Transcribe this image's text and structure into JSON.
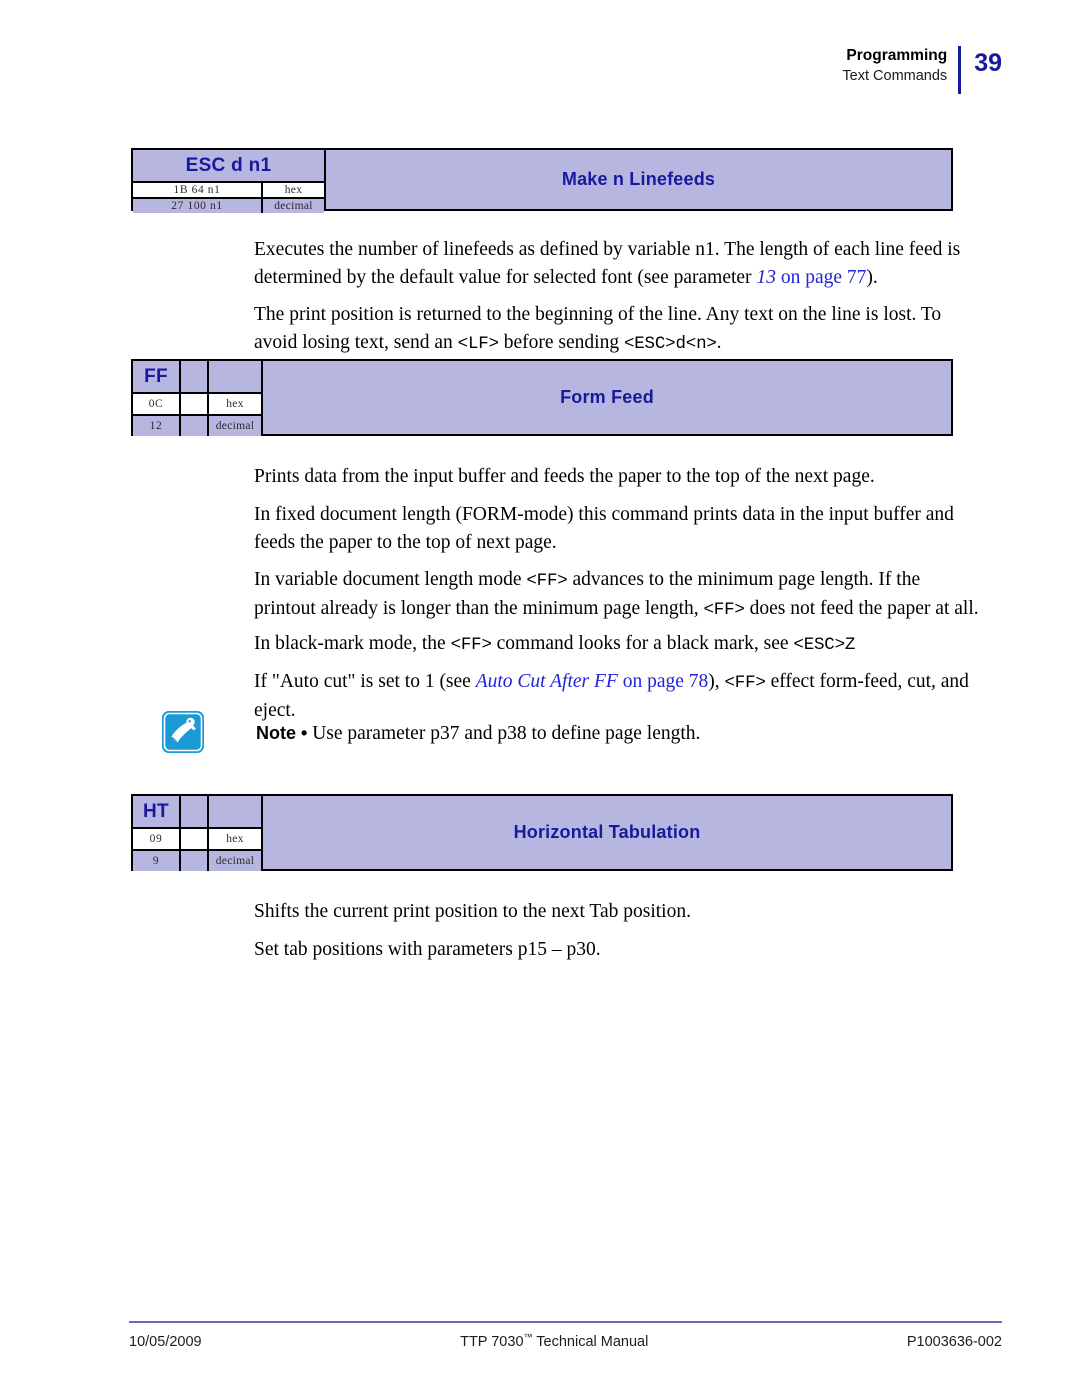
{
  "header": {
    "chapter": "Programming",
    "section": "Text Commands",
    "page_number": "39",
    "accent_color": "#18199c"
  },
  "commands": [
    {
      "id": "esc-d-n1",
      "name": "ESC d  n1",
      "title": "Make n Linefeeds",
      "hex_value": "1B 64  n1",
      "hex_label": "hex",
      "decimal_value": "27 100  n1",
      "decimal_label": "decimal",
      "has_middle_column": false
    },
    {
      "id": "ff",
      "name": "FF",
      "title": "Form Feed",
      "hex_value": "0C",
      "hex_label": "hex",
      "decimal_value": "12",
      "decimal_label": "decimal",
      "has_middle_column": true
    },
    {
      "id": "ht",
      "name": "HT",
      "title": "Horizontal Tabulation",
      "hex_value": "09",
      "hex_label": "hex",
      "decimal_value": "9",
      "decimal_label": "decimal",
      "has_middle_column": true
    }
  ],
  "body": {
    "esc_d_p1_a": "Executes the number of linefeeds as defined by variable n1. The length of each line feed is determined by the default value for selected font (see parameter ",
    "esc_d_p1_link_italic": "13",
    "esc_d_p1_link_rest": " on page 77",
    "esc_d_p1_b": ").",
    "esc_d_p2_a": "The print position is returned to the beginning of the line. Any text on the line is lost. To avoid losing text, send an ",
    "esc_d_p2_code1": "<LF>",
    "esc_d_p2_b": " before sending ",
    "esc_d_p2_code2": "<ESC>d<n>",
    "esc_d_p2_c": ".",
    "ff_p1": "Prints data from the input buffer and feeds the paper to the top of the next page.",
    "ff_p2": "In fixed document length (FORM-mode) this command prints data in the input buffer and feeds the paper to the top of next page.",
    "ff_p3_a": "In variable document length mode ",
    "ff_p3_code1": "<FF>",
    "ff_p3_b": " advances to the minimum page length. If the printout already is longer than the minimum page length, ",
    "ff_p3_code2": "<FF>",
    "ff_p3_c": " does not feed the paper at all.",
    "ff_p4_a": "In black-mark mode, the ",
    "ff_p4_code1": "<FF>",
    "ff_p4_b": " command looks for a black mark, see ",
    "ff_p4_code2": "<ESC>Z",
    "ff_p5_a": "If \"Auto cut\" is set to 1 (see ",
    "ff_p5_link_italic": "Auto Cut After FF",
    "ff_p5_link_rest": " on page 78",
    "ff_p5_b": "), ",
    "ff_p5_code1": "<FF>",
    "ff_p5_c": " effect form-feed, cut, and eject.",
    "note_lead": "Note •",
    "note_text": " Use parameter p37 and p38 to define page length.",
    "ht_p1": "Shifts the current print position to the next Tab position.",
    "ht_p2": "Set tab positions with parameters p15 – p30."
  },
  "footer": {
    "date": "10/05/2009",
    "manual_a": "TTP 7030",
    "manual_tm": "™",
    "manual_b": " Technical Manual",
    "doc_id": "P1003636-002"
  }
}
